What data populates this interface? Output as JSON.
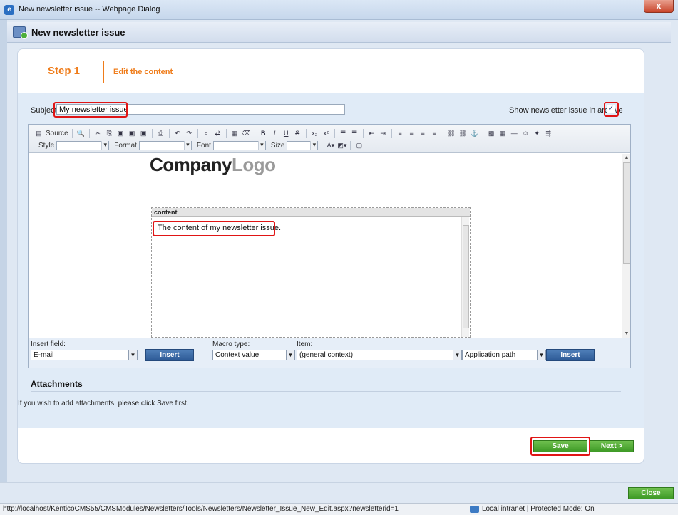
{
  "window": {
    "title": "New newsletter issue -- Webpage Dialog",
    "close_label": "x"
  },
  "dialog": {
    "title": "New newsletter issue"
  },
  "step": {
    "number": "Step 1",
    "label": "Edit the content"
  },
  "form": {
    "subject_label": "Subject:",
    "subject_value": "My newsletter issue",
    "archive_label": "Show newsletter issue in archive",
    "archive_checked": true
  },
  "toolbar": {
    "source_label": "Source",
    "style_label": "Style",
    "format_label": "Format",
    "font_label": "Font",
    "size_label": "Size"
  },
  "editor": {
    "logo_dark": "Company",
    "logo_light": "Logo",
    "region_label": "content",
    "content_text": "The content of my newsletter issue."
  },
  "insert": {
    "field_label": "Insert field:",
    "field_value": "E-mail",
    "insert_button": "Insert",
    "macro_label": "Macro type:",
    "macro_value": "Context value",
    "item_label": "Item:",
    "item_value": "(general context)",
    "item_path_value": "Application path",
    "insert_button2": "Insert"
  },
  "attachments": {
    "title": "Attachments",
    "text": "If you wish to add attachments, please click Save first."
  },
  "buttons": {
    "save": "Save",
    "next": "Next >",
    "close": "Close"
  },
  "statusbar": {
    "url": "http://localhost/KenticoCMS55/CMSModules/Newsletters/Tools/Newsletters/Newsletter_Issue_New_Edit.aspx?newsletterid=1",
    "zone": "Local intranet | Protected Mode: On"
  },
  "colors": {
    "accent": "#ef7c1a",
    "highlight": "#e01515",
    "save_green": "#4caf3a",
    "insert_blue": "#2d5a96"
  }
}
